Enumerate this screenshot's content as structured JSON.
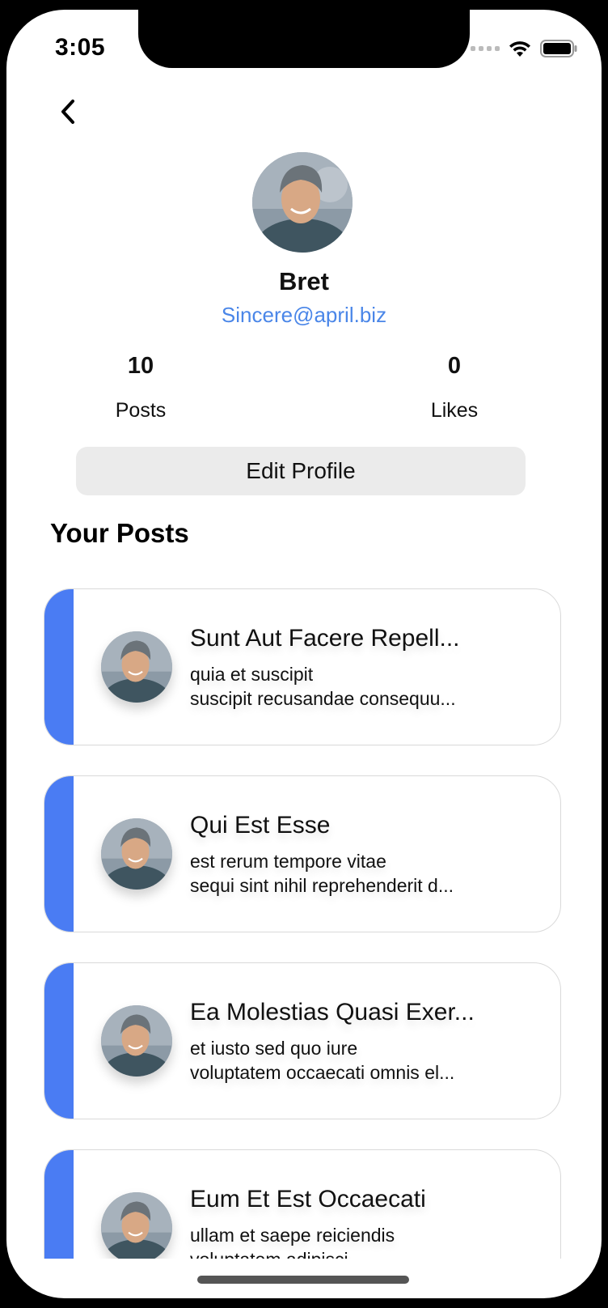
{
  "status_bar": {
    "time": "3:05"
  },
  "profile": {
    "name": "Bret",
    "email": "Sincere@april.biz",
    "stats": {
      "posts_count": "10",
      "posts_label": "Posts",
      "likes_count": "0",
      "likes_label": "Likes"
    },
    "edit_button": "Edit Profile"
  },
  "section_title": "Your Posts",
  "posts": [
    {
      "title": "Sunt Aut Facere Repell...",
      "body_line1": "quia et suscipit",
      "body_line2": "suscipit recusandae consequu..."
    },
    {
      "title": "Qui Est Esse",
      "body_line1": "est rerum tempore vitae",
      "body_line2": "sequi sint nihil reprehenderit d..."
    },
    {
      "title": "Ea Molestias Quasi Exer...",
      "body_line1": "et iusto sed quo iure",
      "body_line2": "voluptatem occaecati omnis el..."
    },
    {
      "title": "Eum Et Est Occaecati",
      "body_line1": "ullam et saepe reiciendis",
      "body_line2": "voluptatem adipisci..."
    }
  ],
  "colors": {
    "accent": "#4a7cf3",
    "link": "#4a86e8",
    "button_bg": "#ebebeb"
  },
  "icons": {
    "back": "chevron-left-icon",
    "wifi": "wifi-icon",
    "battery": "battery-icon",
    "avatar": "user-avatar"
  }
}
